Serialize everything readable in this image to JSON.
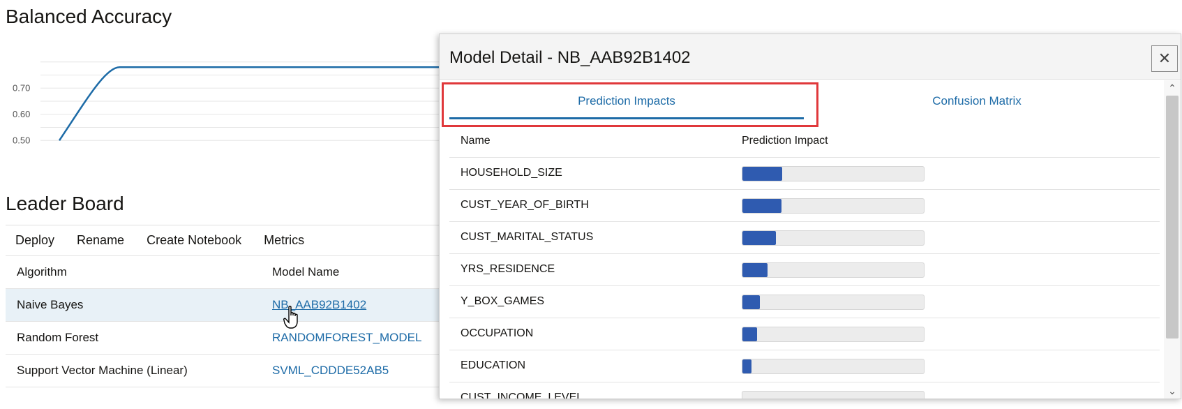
{
  "chart_section": {
    "title": "Balanced Accuracy"
  },
  "chart_data": {
    "type": "line",
    "title": "",
    "xlabel": "",
    "ylabel": "",
    "y_ticks": [
      "0.70",
      "0.60",
      "0.50"
    ],
    "ylim": [
      0.45,
      0.85
    ],
    "grid": true,
    "series": [
      {
        "x": [
          0,
          1,
          2,
          3,
          4,
          5,
          6,
          7
        ],
        "y": [
          0.5,
          0.78,
          0.78,
          0.78,
          0.78,
          0.78,
          0.78,
          0.78
        ]
      }
    ],
    "color": "#1d6ba7"
  },
  "leader_board": {
    "title": "Leader Board",
    "toolbar": [
      "Deploy",
      "Rename",
      "Create Notebook",
      "Metrics"
    ],
    "columns": {
      "algorithm": "Algorithm",
      "model_name": "Model Name"
    },
    "rows": [
      {
        "algorithm": "Naive Bayes",
        "model_name": "NB_AAB92B1402",
        "selected": true
      },
      {
        "algorithm": "Random Forest",
        "model_name": "RANDOMFOREST_MODEL",
        "selected": false
      },
      {
        "algorithm": "Support Vector Machine (Linear)",
        "model_name": "SVML_CDDDE52AB5",
        "selected": false
      }
    ]
  },
  "dialog": {
    "title": "Model Detail - NB_AAB92B1402",
    "close_icon": "close-icon",
    "tabs": [
      "Prediction Impacts",
      "Confusion Matrix"
    ],
    "active_tab": "Prediction Impacts",
    "columns": {
      "name": "Name",
      "impact": "Prediction Impact"
    },
    "impacts": [
      {
        "name": "HOUSEHOLD_SIZE",
        "impact": 0.22
      },
      {
        "name": "CUST_YEAR_OF_BIRTH",
        "impact": 0.215
      },
      {
        "name": "CUST_MARITAL_STATUS",
        "impact": 0.185
      },
      {
        "name": "YRS_RESIDENCE",
        "impact": 0.14
      },
      {
        "name": "Y_BOX_GAMES",
        "impact": 0.095
      },
      {
        "name": "OCCUPATION",
        "impact": 0.08
      },
      {
        "name": "EDUCATION",
        "impact": 0.05
      },
      {
        "name": "CUST_INCOME_LEVEL",
        "impact": 0.0
      }
    ],
    "colors": {
      "accent": "#1d6ba7",
      "bar": "#2f5bb0",
      "highlight": "#e0383b"
    }
  }
}
